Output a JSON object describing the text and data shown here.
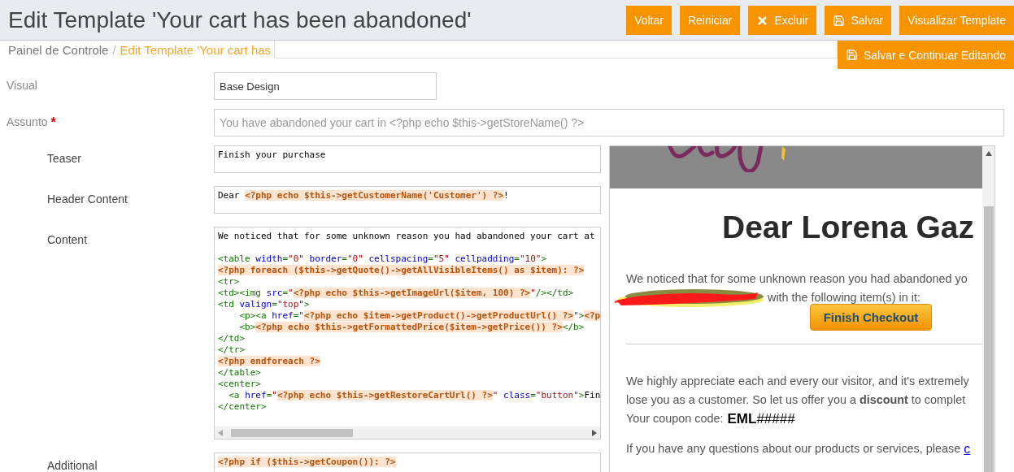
{
  "header": {
    "title": "Edit Template 'Your cart has been abandoned'",
    "buttons": [
      {
        "label": "Voltar",
        "kind": "plain"
      },
      {
        "label": "Reiniciar",
        "kind": "plain"
      },
      {
        "label": "Excluir",
        "kind": "delete"
      },
      {
        "label": "Salvar",
        "kind": "save"
      },
      {
        "label": "Visualizar Template",
        "kind": "plain"
      }
    ],
    "floating_button": {
      "label": "Salvar e Continuar Editando",
      "kind": "save"
    }
  },
  "breadcrumb": {
    "separator": "/",
    "items": [
      {
        "label": "Painel de Controle",
        "selected": false
      },
      {
        "label": "Edit Template 'Your cart has",
        "selected": true
      }
    ]
  },
  "fields": [
    {
      "label": "Visual",
      "value": "Base Design"
    },
    {
      "label": "Assunto",
      "required_mark": "*",
      "placeholder": "You have abandoned your cart in <?php echo $this->getStoreName() ?>"
    }
  ],
  "editors": [
    {
      "label": "Teaser",
      "scrollbar": false,
      "lines": [
        {
          "segments": [
            {
              "kind": "text",
              "text": "Finish your purchase"
            }
          ]
        }
      ]
    },
    {
      "label": "Header Content",
      "scrollbar": false,
      "lines": [
        {
          "segments": [
            {
              "kind": "text",
              "text": "Dear "
            },
            {
              "kind": "php",
              "text": "<?php echo $this->getCustomerName('Customer') ?>"
            },
            {
              "kind": "text",
              "text": "!"
            }
          ]
        }
      ]
    },
    {
      "label": "Content",
      "scrollbar": true,
      "lines": [
        {
          "segments": [
            {
              "kind": "text",
              "text": "We noticed that for some unknown reason you had abandoned your cart at"
            }
          ]
        },
        {
          "blank_before": true,
          "segments": [
            {
              "kind": "tag",
              "text": "<table "
            },
            {
              "kind": "attr",
              "text": "width"
            },
            {
              "kind": "tag",
              "text": "="
            },
            {
              "kind": "string",
              "text": "\"0\" "
            },
            {
              "kind": "attr",
              "text": "border"
            },
            {
              "kind": "tag",
              "text": "="
            },
            {
              "kind": "string",
              "text": "\"0\" "
            },
            {
              "kind": "attr",
              "text": "cellspacing"
            },
            {
              "kind": "tag",
              "text": "="
            },
            {
              "kind": "string",
              "text": "\"5\" "
            },
            {
              "kind": "attr",
              "text": "cellpadding"
            },
            {
              "kind": "tag",
              "text": "="
            },
            {
              "kind": "string",
              "text": "\"10\""
            },
            {
              "kind": "tag",
              "text": ">"
            }
          ]
        },
        {
          "segments": [
            {
              "kind": "php",
              "text": "<?php foreach ($this->getQuote()->getAllVisibleItems() as $item): ?>"
            }
          ]
        },
        {
          "segments": [
            {
              "kind": "tag",
              "text": "<tr>"
            }
          ]
        },
        {
          "segments": [
            {
              "kind": "tag",
              "text": "<td><img "
            },
            {
              "kind": "attr",
              "text": "src"
            },
            {
              "kind": "tag",
              "text": "="
            },
            {
              "kind": "string",
              "text": "\""
            },
            {
              "kind": "php",
              "text": "<?php echo $this->getImageUrl($item, 100) ?>"
            },
            {
              "kind": "string",
              "text": "\""
            },
            {
              "kind": "tag",
              "text": "/></td>"
            }
          ]
        },
        {
          "segments": [
            {
              "kind": "tag",
              "text": "<td "
            },
            {
              "kind": "attr",
              "text": "valign"
            },
            {
              "kind": "tag",
              "text": "="
            },
            {
              "kind": "string",
              "text": "\"top\""
            },
            {
              "kind": "tag",
              "text": ">"
            }
          ]
        },
        {
          "segments": [
            {
              "kind": "tag",
              "text": "    <p><a "
            },
            {
              "kind": "attr",
              "text": "href"
            },
            {
              "kind": "tag",
              "text": "="
            },
            {
              "kind": "string",
              "text": "\""
            },
            {
              "kind": "php",
              "text": "<?php echo $item->getProduct()->getProductUrl() ?>"
            },
            {
              "kind": "string",
              "text": "\""
            },
            {
              "kind": "tag",
              "text": ">"
            },
            {
              "kind": "php",
              "text": "<?p"
            }
          ]
        },
        {
          "segments": [
            {
              "kind": "tag",
              "text": "    <b>"
            },
            {
              "kind": "php",
              "text": "<?php echo $this->getFormattedPrice($item->getPrice()) ?>"
            },
            {
              "kind": "tag",
              "text": "</b>"
            }
          ]
        },
        {
          "segments": [
            {
              "kind": "tag",
              "text": "</td>"
            }
          ]
        },
        {
          "segments": [
            {
              "kind": "tag",
              "text": "</tr>"
            }
          ]
        },
        {
          "segments": [
            {
              "kind": "php",
              "text": "<?php endforeach ?>"
            }
          ]
        },
        {
          "segments": [
            {
              "kind": "tag",
              "text": "</table>"
            }
          ]
        },
        {
          "segments": [
            {
              "kind": "tag",
              "text": "<center>"
            }
          ]
        },
        {
          "segments": [
            {
              "kind": "tag",
              "text": "  <a "
            },
            {
              "kind": "attr",
              "text": "href"
            },
            {
              "kind": "tag",
              "text": "="
            },
            {
              "kind": "string",
              "text": "\""
            },
            {
              "kind": "php",
              "text": "<?php echo $this->getRestoreCartUrl() ?>"
            },
            {
              "kind": "string",
              "text": "\" "
            },
            {
              "kind": "attr",
              "text": "class"
            },
            {
              "kind": "tag",
              "text": "="
            },
            {
              "kind": "string",
              "text": "\"button\""
            },
            {
              "kind": "tag",
              "text": ">"
            },
            {
              "kind": "text",
              "text": "Fin"
            }
          ]
        },
        {
          "segments": [
            {
              "kind": "tag",
              "text": "</center>"
            }
          ]
        }
      ]
    },
    {
      "label": "Additional",
      "scrollbar": false,
      "lines": [
        {
          "segments": [
            {
              "kind": "php",
              "text": "<?php if ($this->getCoupon()): ?>"
            }
          ]
        }
      ]
    }
  ],
  "preview": {
    "heading": "Dear Lorena Gaz",
    "intro_line": "We noticed that for some unknown reason you had abandoned yo",
    "items_line": "with the following item(s) in it:",
    "button": "Finish Checkout",
    "offer_lines": [
      "We highly appreciate each and every our visitor, and it's extremely",
      "lose you as a customer. So let us offer you a **discount** to complet"
    ],
    "coupon_label": "Your coupon code:",
    "coupon_code": "**EML**#####",
    "contact_text": "If you have any questions about our products or services, please",
    "contact_link": "c"
  }
}
